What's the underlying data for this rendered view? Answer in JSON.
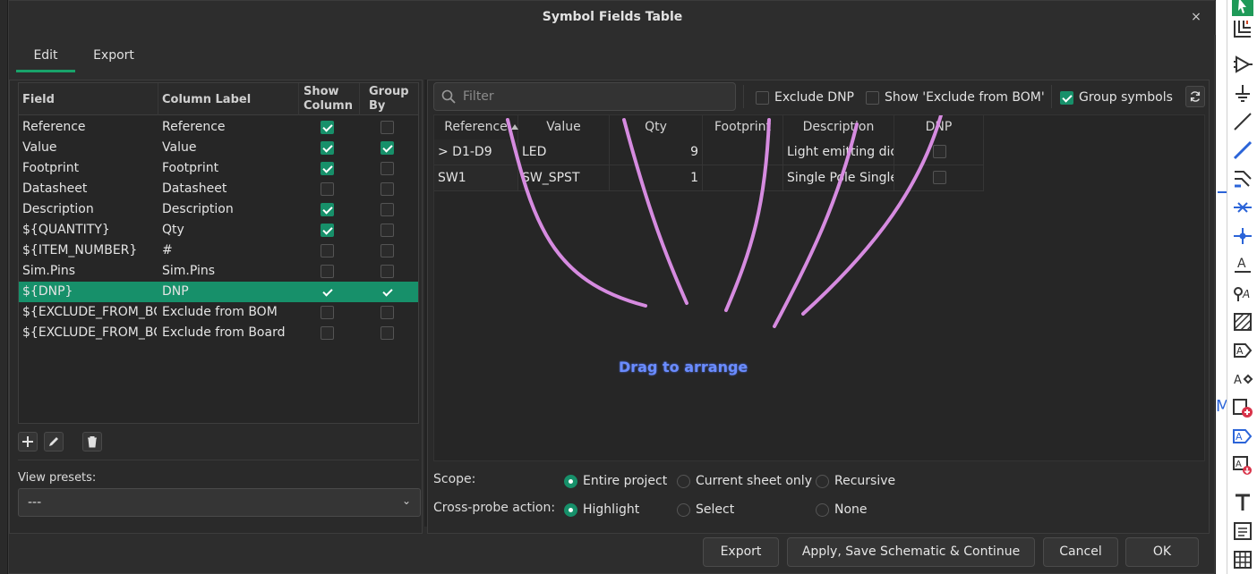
{
  "dialog": {
    "title": "Symbol Fields Table",
    "close_glyph": "×"
  },
  "tabs": [
    {
      "label": "Edit",
      "active": true
    },
    {
      "label": "Export",
      "active": false
    }
  ],
  "fields_grid": {
    "headers": {
      "field": "Field",
      "column_label": "Column Label",
      "show_column": [
        "Show",
        "Column"
      ],
      "group_by": [
        "Group",
        "By"
      ]
    },
    "rows": [
      {
        "field": "Reference",
        "label": "Reference",
        "show": true,
        "group": false
      },
      {
        "field": "Value",
        "label": "Value",
        "show": true,
        "group": true
      },
      {
        "field": "Footprint",
        "label": "Footprint",
        "show": true,
        "group": false
      },
      {
        "field": "Datasheet",
        "label": "Datasheet",
        "show": false,
        "group": false
      },
      {
        "field": "Description",
        "label": "Description",
        "show": true,
        "group": false
      },
      {
        "field": "${QUANTITY}",
        "label": "Qty",
        "show": true,
        "group": false
      },
      {
        "field": "${ITEM_NUMBER}",
        "label": "#",
        "show": false,
        "group": false
      },
      {
        "field": "Sim.Pins",
        "label": "Sim.Pins",
        "show": false,
        "group": false
      },
      {
        "field": "${DNP}",
        "label": "DNP",
        "show": true,
        "group": true,
        "selected": true
      },
      {
        "field": "${EXCLUDE_FROM_BO",
        "label": "Exclude from BOM",
        "show": false,
        "group": false
      },
      {
        "field": "${EXCLUDE_FROM_BO",
        "label": "Exclude from Board",
        "show": false,
        "group": false
      }
    ]
  },
  "view_presets": {
    "label": "View presets:",
    "value": "---"
  },
  "filter": {
    "placeholder": "Filter"
  },
  "options": {
    "exclude_dnp": {
      "label": "Exclude DNP",
      "checked": false
    },
    "show_exclude_bom": {
      "label": "Show 'Exclude from BOM'",
      "checked": false
    },
    "group_symbols": {
      "label": "Group symbols",
      "checked": true
    }
  },
  "data_grid": {
    "columns": [
      "Reference",
      "Value",
      "Qty",
      "Footprint",
      "Description",
      "DNP"
    ],
    "rows": [
      {
        "reference": "> D1-D9",
        "value": "LED",
        "qty": "9",
        "footprint": "",
        "description": "Light emitting dio",
        "dnp": false
      },
      {
        "reference": "SW1",
        "value": "SW_SPST",
        "qty": "1",
        "footprint": "",
        "description": "Single Pole Single T",
        "dnp": false
      }
    ],
    "overlay_text": "Drag to arrange"
  },
  "scope": {
    "label": "Scope:",
    "options": [
      {
        "label": "Entire project",
        "selected": true
      },
      {
        "label": "Current sheet only",
        "selected": false
      },
      {
        "label": "Recursive",
        "selected": false
      }
    ]
  },
  "cross_probe": {
    "label": "Cross-probe action:",
    "options": [
      {
        "label": "Highlight",
        "selected": true
      },
      {
        "label": "Select",
        "selected": false
      },
      {
        "label": "None",
        "selected": false
      }
    ]
  },
  "buttons": {
    "export": "Export",
    "apply": "Apply, Save Schematic & Continue",
    "cancel": "Cancel",
    "ok": "OK"
  },
  "colors": {
    "accent": "#17906a",
    "drag_text": "#6a8cff",
    "stroke": "#d68be0"
  },
  "toolbar_icons": [
    "select-arrow-icon",
    "hierarchy-icon",
    "add-symbol-icon",
    "power-icon",
    "line-icon",
    "wire-icon",
    "bus-icon",
    "no-connect-icon",
    "junction-icon",
    "label-icon",
    "net-class-icon",
    "rule-area-icon",
    "global-label-icon",
    "hier-label-icon",
    "add-sheet-icon",
    "sheet-pin-icon",
    "import-sheet-pin-icon",
    "text-icon",
    "textbox-icon",
    "table-icon"
  ]
}
